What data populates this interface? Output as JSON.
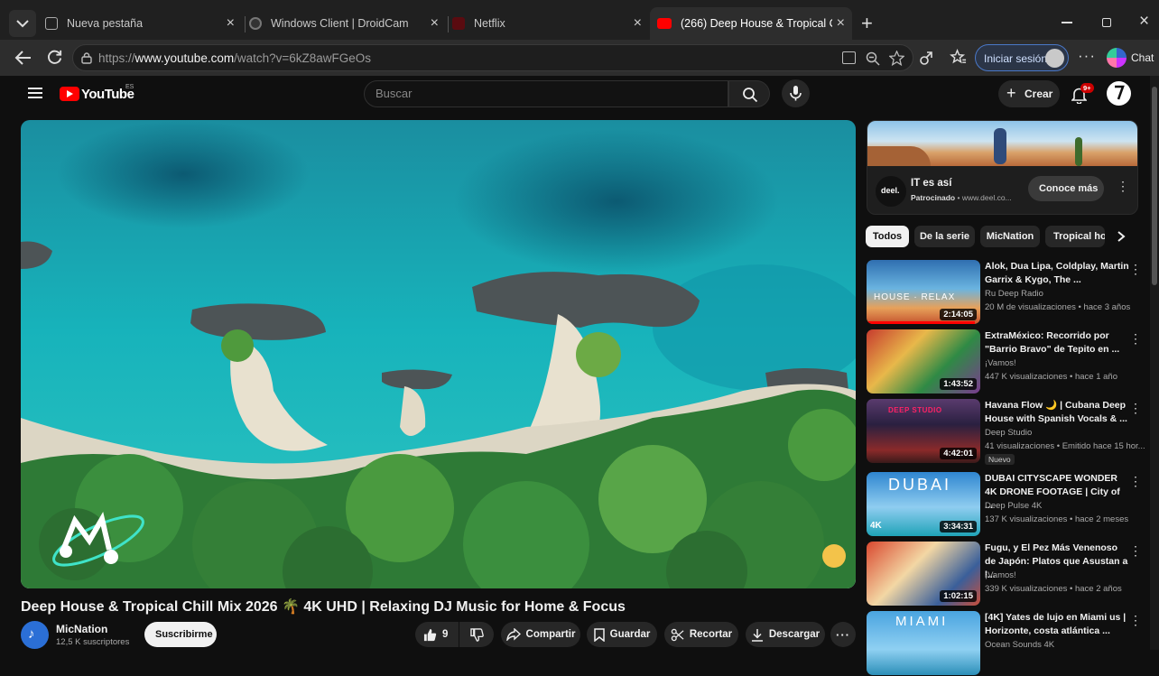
{
  "browser": {
    "tabs": [
      {
        "title": "Nueva pestaña"
      },
      {
        "title": "Windows Client | DroidCam"
      },
      {
        "title": "Netflix"
      },
      {
        "title": "(266) Deep House & Tropical Chill"
      }
    ],
    "url_scheme": "https://",
    "url_host": "www.youtube.com",
    "url_path": "/watch?v=6kZ8awFGeOs",
    "signin_label": "Iniciar sesión",
    "chat_label": "Chat"
  },
  "youtube": {
    "logo_text": "YouTube",
    "logo_country": "ES",
    "search_placeholder": "Buscar",
    "create_label": "Crear",
    "notif_count": "9+",
    "video_title": "Deep House & Tropical Chill Mix 2026 🌴 4K UHD | Relaxing DJ Music for Home & Focus",
    "channel_name": "MicNation",
    "subscribers": "12,5 K suscriptores",
    "subscribe_label": "Suscribirme",
    "likes": "9",
    "share_label": "Compartir",
    "save_label": "Guardar",
    "clip_label": "Recortar",
    "download_label": "Descargar"
  },
  "ad": {
    "title": "IT es así",
    "sponsor": "Patrocinado",
    "domain": "www.deel.co...",
    "brand": "deel.",
    "cta": "Conoce más"
  },
  "chips": [
    "Todos",
    "De la serie",
    "MicNation",
    "Tropical ho"
  ],
  "recommendations": [
    {
      "title": "Alok, Dua Lipa, Coldplay, Martin Garrix & Kygo, The ...",
      "channel": "Ru Deep Radio",
      "stats": "20 M de visualizaciones • hace 3 años",
      "duration": "2:14:05",
      "thumb_text": "HOUSE · RELAX"
    },
    {
      "title": "ExtraMéxico: Recorrido por \"Barrio Bravo\" de Tepito en ...",
      "channel": "¡Vamos!",
      "stats": "447 K visualizaciones • hace 1 año",
      "duration": "1:43:52",
      "thumb_text": ""
    },
    {
      "title": "Havana Flow 🌙 | Cubana Deep House with Spanish Vocals & ...",
      "channel": "Deep Studio",
      "stats": "41 visualizaciones • Emitido hace 15 hor...",
      "duration": "4:42:01",
      "badge": "Nuevo",
      "thumb_text": "DEEP STUDIO"
    },
    {
      "title": "DUBAI CITYSCAPE WONDER 4K DRONE FOOTAGE | City of ...",
      "channel": "Deep Pulse 4K",
      "stats": "137 K visualizaciones • hace 2 meses",
      "duration": "3:34:31",
      "thumb_text": "DUBAI",
      "thumb_badge": "4K"
    },
    {
      "title": "Fugu, y El Pez Más Venenoso de Japón: Platos que Asustan a l...",
      "channel": "¡Vamos!",
      "stats": "339 K visualizaciones • hace 2 años",
      "duration": "1:02:15",
      "thumb_text": ""
    },
    {
      "title": "[4K] Yates de lujo en Miami us | Horizonte, costa atlántica ...",
      "channel": "Ocean Sounds 4K",
      "stats": "",
      "duration": "",
      "thumb_text": "MIAMI"
    }
  ],
  "colors": {
    "yt_red": "#ff0000",
    "bg": "#0f0f0f",
    "accent_blue": "#3ea6ff"
  }
}
